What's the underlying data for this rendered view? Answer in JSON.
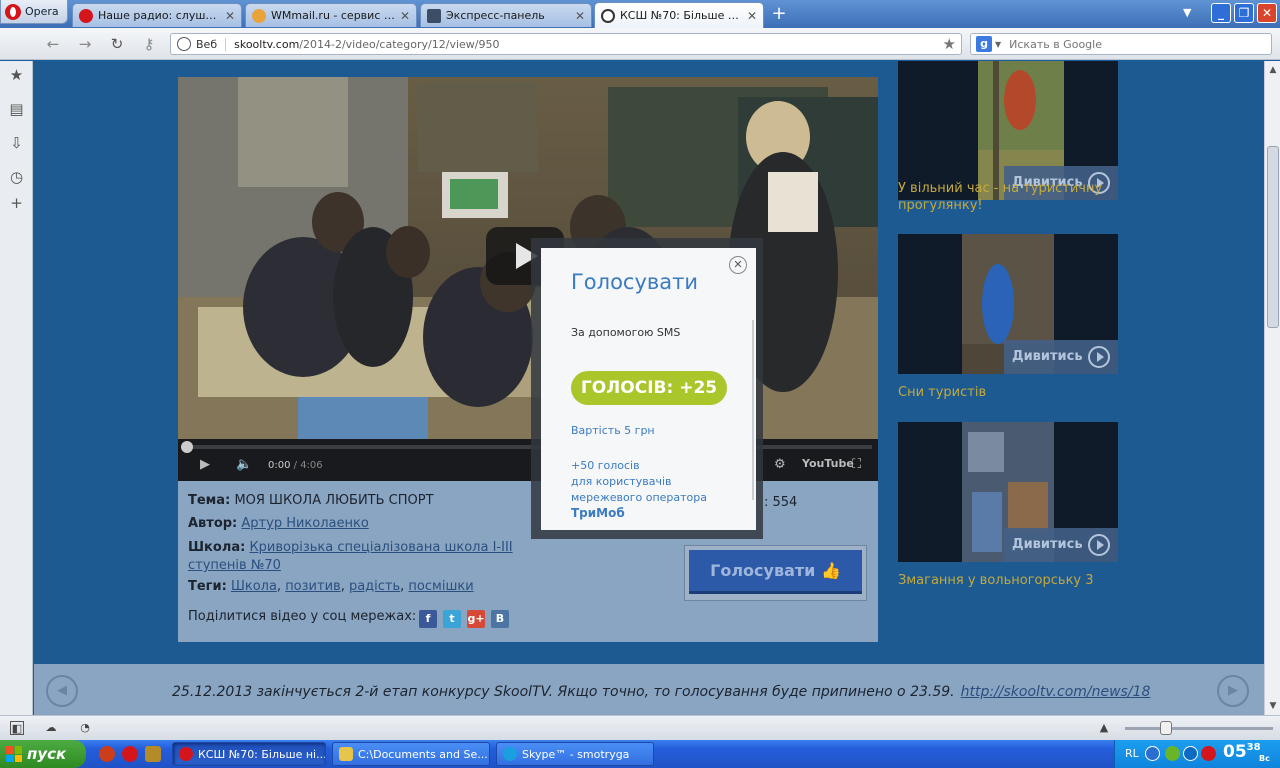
{
  "browser": {
    "menu_label": "Opera",
    "tabs": [
      {
        "title": "Наше радио: слушать ...",
        "icon": "opera-red-icon",
        "color": "#d4161c"
      },
      {
        "title": "WMmail.ru - сервис поч...",
        "icon": "wmmail-icon",
        "color": "#e8a33a"
      },
      {
        "title": "Экспресс-панель",
        "icon": "speed-dial-icon",
        "color": "#3c4d66"
      },
      {
        "title": "КСШ №70: Більше ніж ...",
        "icon": "skooltv-icon",
        "color": "#333333",
        "active": true
      }
    ],
    "new_tab": "+",
    "url_scheme": "Веб",
    "url_host": "skooltv.com",
    "url_path": "/2014-2/video/category/12/view/950",
    "search_engine": "g",
    "search_placeholder": "Искать в Google"
  },
  "video": {
    "time_current": "0:00",
    "time_total": " / 4:06",
    "progress": 0,
    "youtube_label": "YouTube"
  },
  "info": {
    "theme_label": "Тема:",
    "theme": "МОЯ ШКОЛА ЛЮБИТЬ СПОРТ",
    "author_label": "Автор:",
    "author": "Артур Николаенко",
    "school_label": "Школа:",
    "school_line1": "Криворізька спеціалізована школа І-ІІІ",
    "school_line2": "ступенів №70",
    "tags_label": "Теги:",
    "tags": [
      "Школа",
      "позитив",
      "радість",
      "посмішки"
    ],
    "views_suffix": ": 554",
    "vote_button": "Голосувати",
    "share_label": "Поділитися відео у соц мережах:",
    "social": [
      {
        "name": "facebook",
        "letter": "f",
        "color": "#3b5998"
      },
      {
        "name": "twitter",
        "letter": "t",
        "color": "#3aa4d8"
      },
      {
        "name": "googleplus",
        "letter": "g+",
        "color": "#d64937"
      },
      {
        "name": "vkontakte",
        "letter": "B",
        "color": "#4c75a3"
      }
    ]
  },
  "sidebar": [
    {
      "title": "У вільний час - на туристичну прогулянку!",
      "watch": "Дивитись"
    },
    {
      "title": "Сни туристів",
      "watch": "Дивитись"
    },
    {
      "title": "Змагання у вольногорську 3",
      "watch": "Дивитись"
    }
  ],
  "news": {
    "text": "25.12.2013 закінчується 2-й етап конкурсу SkoolTV. Якщо точно, то голосування буде припинено о 23.59.",
    "link": "http://skooltv.com/news/18"
  },
  "modal": {
    "title": "Голосувати",
    "subtitle": "За допомогою SMS",
    "votes_badge": "ГОЛОСІВ: +25",
    "cost": "Вартість 5 грн",
    "bonus_line1": "+50 голосів",
    "bonus_line2": "для користувачів",
    "bonus_line3": "мережевого оператора",
    "operator": "ТриМоб"
  },
  "taskbar": {
    "start_label": "пуск",
    "tasks": [
      {
        "label": "КСШ №70: Більше ні...",
        "icon": "opera-red-icon",
        "color": "#d4161c",
        "active": true
      },
      {
        "label": "C:\\Documents and Se...",
        "icon": "folder-icon",
        "color": "#e7c44a"
      },
      {
        "label": "Skype™ - smotryga",
        "icon": "skype-icon",
        "color": "#1aa0e0"
      }
    ],
    "tray_lang": "RL",
    "clock_hour": "05",
    "clock_min": "38",
    "clock_day": "Вс"
  }
}
